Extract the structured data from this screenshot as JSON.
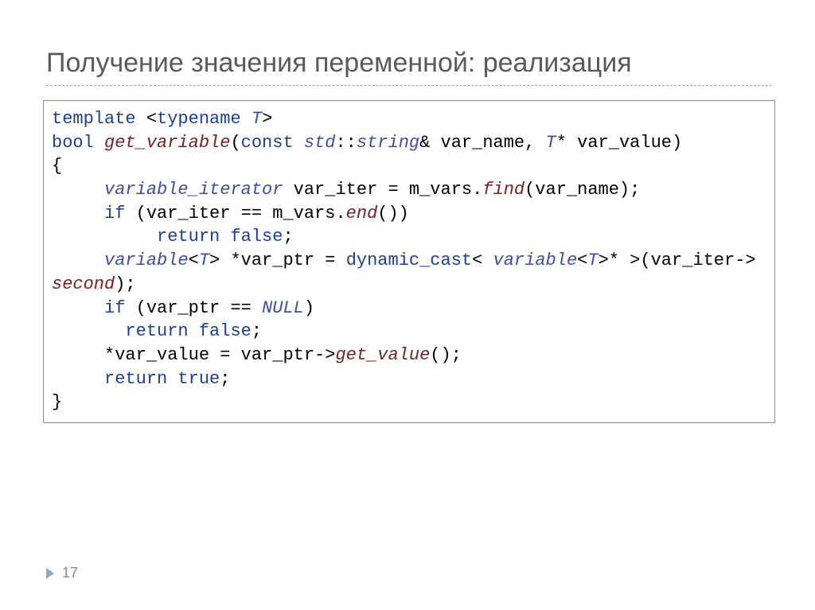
{
  "slide": {
    "title": "Получение значения переменной: реализация",
    "page_number": "17"
  },
  "code": {
    "l1_kw1": "template",
    "l1_p1": " <",
    "l1_kw2": "typename",
    "l1_ty": " T",
    "l1_p2": ">",
    "l2_kw1": "bool",
    "l2_sp": " ",
    "l2_fn": "get_variable",
    "l2_p1": "(",
    "l2_kw2": "const",
    "l2_sp2": " ",
    "l2_ty1": "std",
    "l2_p2": "::",
    "l2_ty2": "string",
    "l2_p3": "& var_name, ",
    "l2_ty3": "T",
    "l2_p4": "* var_value)",
    "l3": "{",
    "l4_ind": "     ",
    "l4_ty": "variable_iterator",
    "l4_txt": " var_iter = m_vars.",
    "l4_fn": "find",
    "l4_p": "(var_name);",
    "l5_ind": "     ",
    "l5_kw": "if",
    "l5_txt": " (var_iter == m_vars.",
    "l5_fn": "end",
    "l5_p": "())",
    "l6_ind": "          ",
    "l6_kw": "return false",
    "l6_p": ";",
    "l7_ind": "     ",
    "l7_ty1": "variable",
    "l7_p1": "<",
    "l7_ty2": "T",
    "l7_p2": "> *var_ptr = ",
    "l7_kw": "dynamic_cast",
    "l7_p3": "< ",
    "l7_ty3": "variable",
    "l7_p4": "<",
    "l7_ty4": "T",
    "l7_p5": ">* >(var_iter->",
    "l7b_fn": "second",
    "l7b_p": ");",
    "l8_ind": "     ",
    "l8_kw": "if",
    "l8_txt": " (var_ptr == ",
    "l8_ty": "NULL",
    "l8_p": ")",
    "l9_ind": "       ",
    "l9_kw": "return false",
    "l9_p": ";",
    "l10_ind": "     *var_value = var_ptr->",
    "l10_fn": "get_value",
    "l10_p": "();",
    "l11_ind": "     ",
    "l11_kw": "return true",
    "l11_p": ";",
    "l12": "}"
  }
}
